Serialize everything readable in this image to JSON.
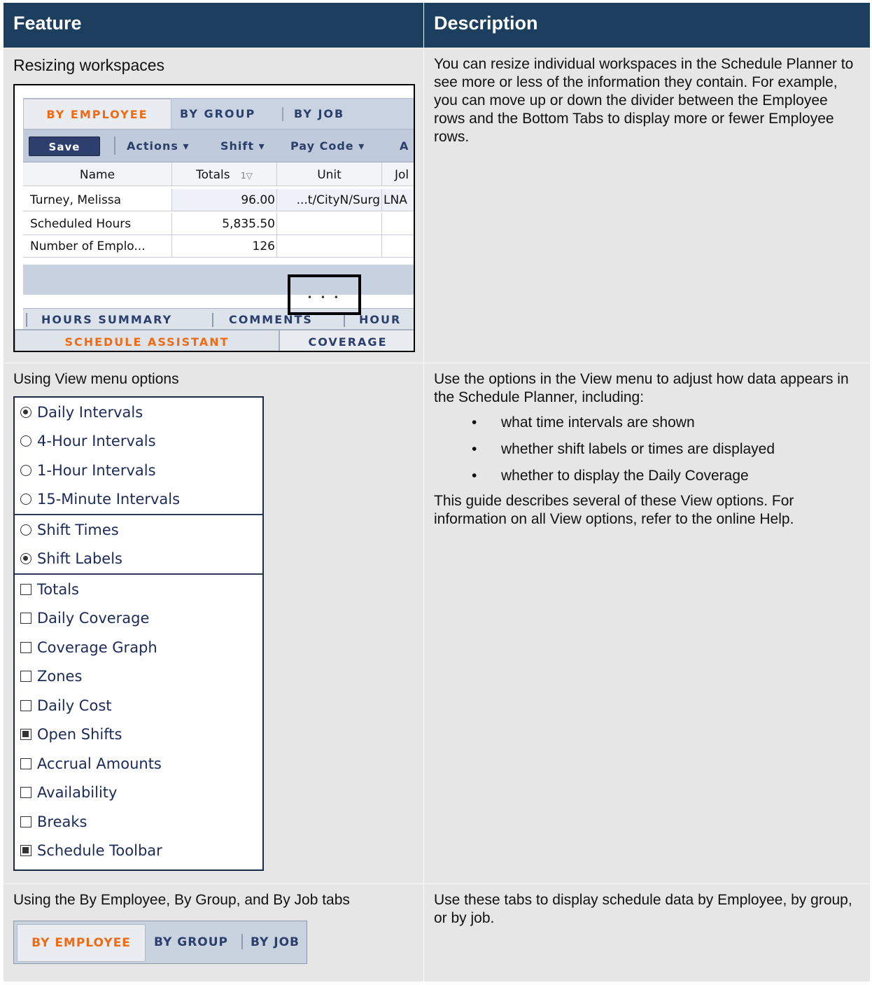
{
  "header": {
    "feature": "Feature",
    "description": "Description"
  },
  "rows": [
    {
      "feature": "Resizing workspaces",
      "description": "You can resize individual workspaces in the Schedule Planner to see more or less of the information they contain. For example, you can move up or down the divider between the Employee rows and the Bottom Tabs to display more or fewer Employee rows.",
      "screenshot": {
        "tabs": [
          "BY EMPLOYEE",
          "BY GROUP",
          "BY JOB"
        ],
        "save_label": "Save",
        "menus": [
          "Actions ▾",
          "Shift ▾",
          "Pay Code ▾",
          "A"
        ],
        "columns": [
          "Name",
          "Totals",
          "Unit",
          "Jol"
        ],
        "sort_indicator": "1▽",
        "grid_rows": [
          {
            "name": "Turney, Melissa",
            "totals": "96.00",
            "unit": "...t/CityN/Surg",
            "job": "LNA"
          },
          {
            "name": "Scheduled Hours",
            "totals": "5,835.50",
            "unit": "",
            "job": ""
          },
          {
            "name": "Number of Emplo...",
            "totals": "126",
            "unit": "",
            "job": ""
          }
        ],
        "divider_dots": "• • •",
        "bottom_tabs_row1": [
          "HOURS SUMMARY",
          "COMMENTS",
          "HOUR"
        ],
        "bottom_tabs_row2": [
          "SCHEDULE ASSISTANT",
          "COVERAGE"
        ]
      }
    },
    {
      "feature": "Using View menu options",
      "description_intro": "Use the options in the View menu to adjust how data appears in the Schedule Planner, including:",
      "bullets": [
        "what time intervals are shown",
        "whether shift labels or times are displayed",
        "whether to display the Daily Coverage"
      ],
      "description_outro": "This guide describes several of these View options. For information on all View options, refer to the online Help.",
      "view_menu": {
        "intervals": [
          {
            "label": "Daily Intervals",
            "selected": true
          },
          {
            "label": "4-Hour Intervals",
            "selected": false
          },
          {
            "label": "1-Hour Intervals",
            "selected": false
          },
          {
            "label": "15-Minute Intervals",
            "selected": false
          }
        ],
        "shift_display": [
          {
            "label": "Shift Times",
            "selected": false
          },
          {
            "label": "Shift Labels",
            "selected": true
          }
        ],
        "toggles": [
          {
            "label": "Totals",
            "checked": false
          },
          {
            "label": "Daily Coverage",
            "checked": false
          },
          {
            "label": "Coverage Graph",
            "checked": false
          },
          {
            "label": "Zones",
            "checked": false
          },
          {
            "label": "Daily Cost",
            "checked": false
          },
          {
            "label": "Open Shifts",
            "checked": true
          },
          {
            "label": "Accrual Amounts",
            "checked": false
          },
          {
            "label": "Availability",
            "checked": false
          },
          {
            "label": "Breaks",
            "checked": false
          },
          {
            "label": "Schedule Toolbar",
            "checked": true
          }
        ]
      }
    },
    {
      "feature": "Using the By Employee, By Group, and By Job tabs",
      "description": "Use these tabs to display schedule data by Employee, by group, or by job.",
      "tabs": [
        "BY EMPLOYEE",
        "BY GROUP",
        "BY JOB"
      ]
    }
  ],
  "colors": {
    "header_bg": "#1c3f5f",
    "cell_bg": "#e6e6e6",
    "active_tab": "#f06a12",
    "tab_text": "#2c3e6b"
  }
}
